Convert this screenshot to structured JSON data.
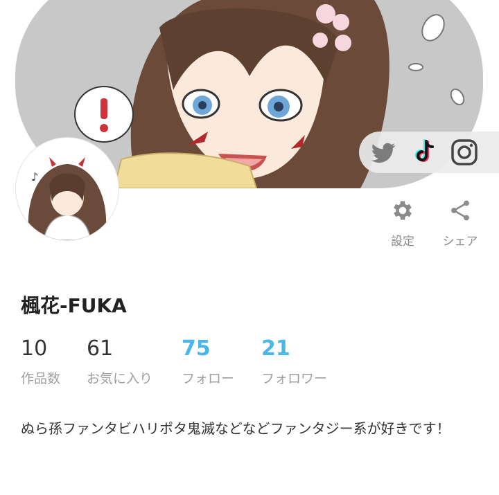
{
  "profile": {
    "name": "楓花-FUKA",
    "bio": "ぬら孫ファンタビハリポタ鬼滅などなどファンタジー系が好きです！"
  },
  "actions": {
    "settings_label": "設定",
    "share_label": "シェア"
  },
  "stats": [
    {
      "value": "10",
      "label": "作品数"
    },
    {
      "value": "61",
      "label": "お気に入り"
    },
    {
      "value": "75",
      "label": "フォロー"
    },
    {
      "value": "21",
      "label": "フォロワー"
    }
  ],
  "social": [
    "twitter-icon",
    "tiktok-icon",
    "instagram-icon"
  ],
  "colors": {
    "accent": "#4ab6ea",
    "muted": "#a0a0a0",
    "text": "#222222",
    "header_bg": "#c9c9c9"
  }
}
